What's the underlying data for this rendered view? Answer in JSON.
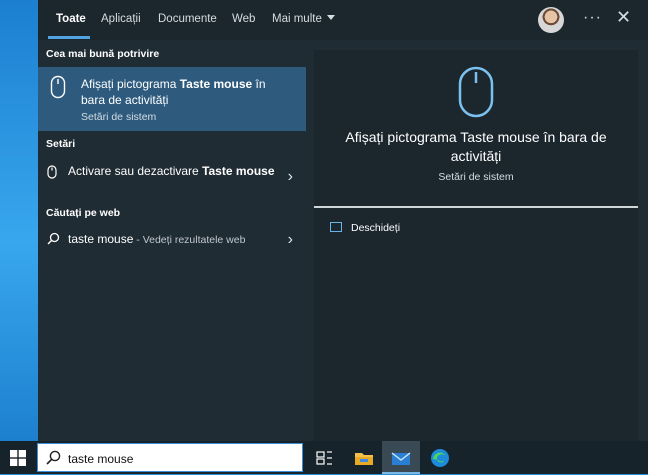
{
  "tabs": [
    {
      "label": "Toate"
    },
    {
      "label": "Aplicații"
    },
    {
      "label": "Documente"
    },
    {
      "label": "Web"
    },
    {
      "label": "Mai multe"
    }
  ],
  "header": {
    "more_options_icon": "ellipsis-icon",
    "close_icon": "close-icon"
  },
  "best_match": {
    "section": "Cea mai bună potrivire",
    "title_plain": "Afișați pictograma ",
    "title_bold": "Taste mouse",
    "title_rest": " în bara de activități",
    "subtitle": "Setări de sistem",
    "icon": "mouse-icon"
  },
  "settings": {
    "section": "Setări",
    "item_plain": "Activare sau dezactivare ",
    "item_bold": "Taste mouse",
    "icon": "mouse-icon"
  },
  "web": {
    "section": "Căutați pe web",
    "query": "taste mouse",
    "suffix": " - Vedeți rezultatele web",
    "icon": "search-icon"
  },
  "preview": {
    "title": "Afișați pictograma Taste mouse în bara de activități",
    "subtitle": "Setări de sistem",
    "open_label": "Deschideți",
    "icon": "mouse-icon"
  },
  "taskbar": {
    "search_value": "taste mouse",
    "icons": [
      "windows-start-icon",
      "search-icon",
      "task-view-icon",
      "file-explorer-icon",
      "mail-icon",
      "edge-icon"
    ]
  },
  "colors": {
    "accent": "#4fa3e0",
    "selected": "#2d5a7d",
    "panel": "#202c33"
  }
}
